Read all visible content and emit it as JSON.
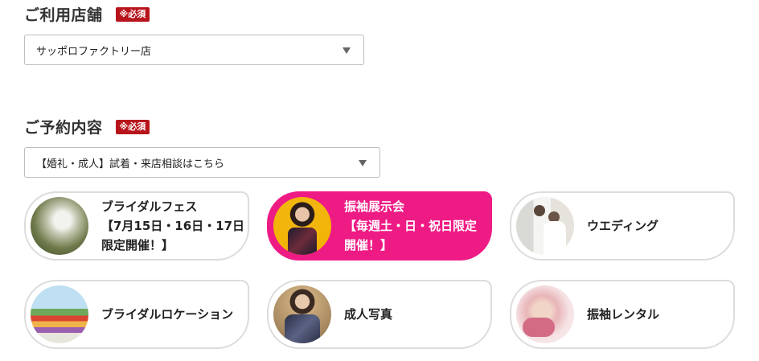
{
  "store": {
    "title": "ご利用店舗",
    "required": "※必須",
    "selected": "サッポロファクトリー店"
  },
  "reservation": {
    "title": "ご予約内容",
    "required": "※必須",
    "selected": "【婚礼・成人】試着・来店相談はこちら"
  },
  "cards": [
    {
      "line1": "ブライダルフェス",
      "line2": "【7月15日・16日・17日",
      "line3": "限定開催！】"
    },
    {
      "line1": "振袖展示会",
      "line2": "【毎週土・日・祝日限定",
      "line3": "開催！】"
    },
    {
      "line1": "ウエディング"
    },
    {
      "line1": "ブライダルロケーション"
    },
    {
      "line1": "成人写真"
    },
    {
      "line1": "振袖レンタル"
    }
  ],
  "colors": {
    "accent": "#ee1b85",
    "required_badge": "#b8141b",
    "card_border": "#dcdcdc"
  }
}
